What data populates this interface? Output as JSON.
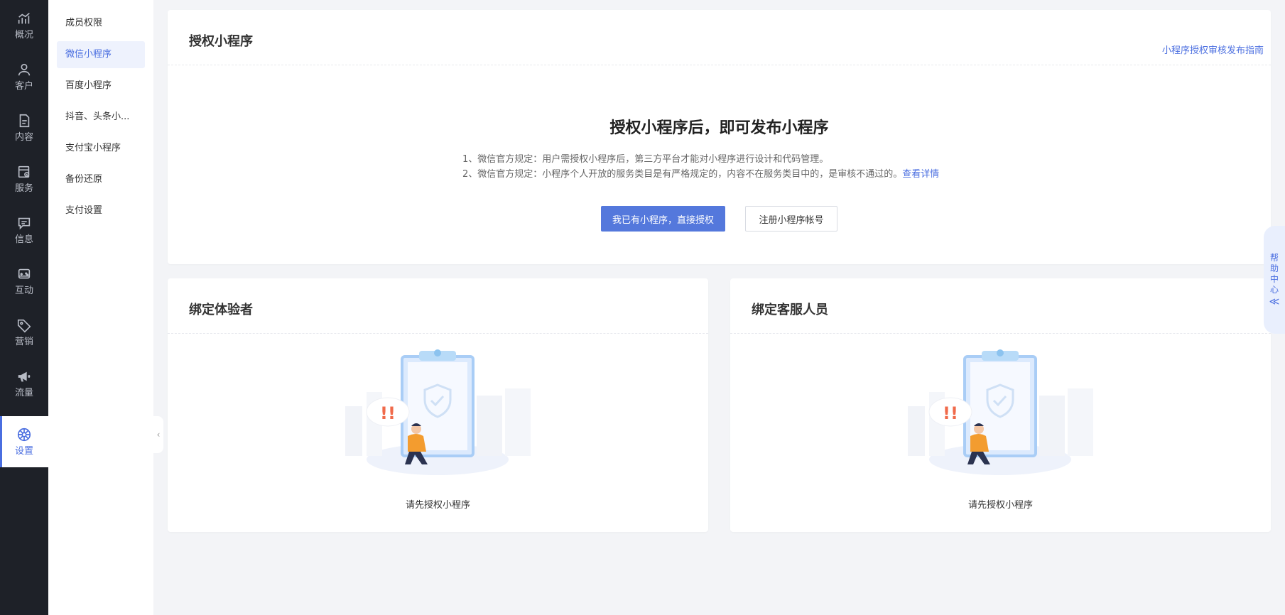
{
  "rail": {
    "items": [
      {
        "label": "概况",
        "icon": "trend-chart-icon"
      },
      {
        "label": "客户",
        "icon": "user-icon"
      },
      {
        "label": "内容",
        "icon": "document-icon"
      },
      {
        "label": "服务",
        "icon": "service-calendar-icon"
      },
      {
        "label": "信息",
        "icon": "message-icon"
      },
      {
        "label": "互动",
        "icon": "gamepad-icon"
      },
      {
        "label": "营销",
        "icon": "tag-icon"
      },
      {
        "label": "流量",
        "icon": "megaphone-icon"
      },
      {
        "label": "设置",
        "icon": "gear-icon"
      }
    ],
    "active_index": 8
  },
  "submenu": {
    "items": [
      {
        "label": "成员权限"
      },
      {
        "label": "微信小程序"
      },
      {
        "label": "百度小程序"
      },
      {
        "label": "抖音、头条小..."
      },
      {
        "label": "支付宝小程序"
      },
      {
        "label": "备份还原"
      },
      {
        "label": "支付设置"
      }
    ],
    "active_index": 1
  },
  "auth_card": {
    "title": "授权小程序",
    "guide_link": "小程序授权审核发布指南",
    "heading": "授权小程序后，即可发布小程序",
    "rule1": "1、微信官方规定：用户需授权小程序后，第三方平台才能对小程序进行设计和代码管理。",
    "rule2": "2、微信官方规定：小程序个人开放的服务类目是有严格规定的，内容不在服务类目中的，是审核不通过的。",
    "rule2_link": "查看详情",
    "primary_button": "我已有小程序，直接授权",
    "secondary_button": "注册小程序帐号"
  },
  "tester_card": {
    "title": "绑定体验者",
    "empty_text": "请先授权小程序"
  },
  "service_card": {
    "title": "绑定客服人员",
    "empty_text": "请先授权小程序"
  },
  "help_tab": {
    "chars": [
      "帮",
      "助",
      "中",
      "心"
    ],
    "chevron": "≪"
  },
  "colors": {
    "accent": "#4a6ee0",
    "primary_button": "#5478dc",
    "rail_bg": "#1e2128",
    "page_bg": "#f3f4f7"
  }
}
